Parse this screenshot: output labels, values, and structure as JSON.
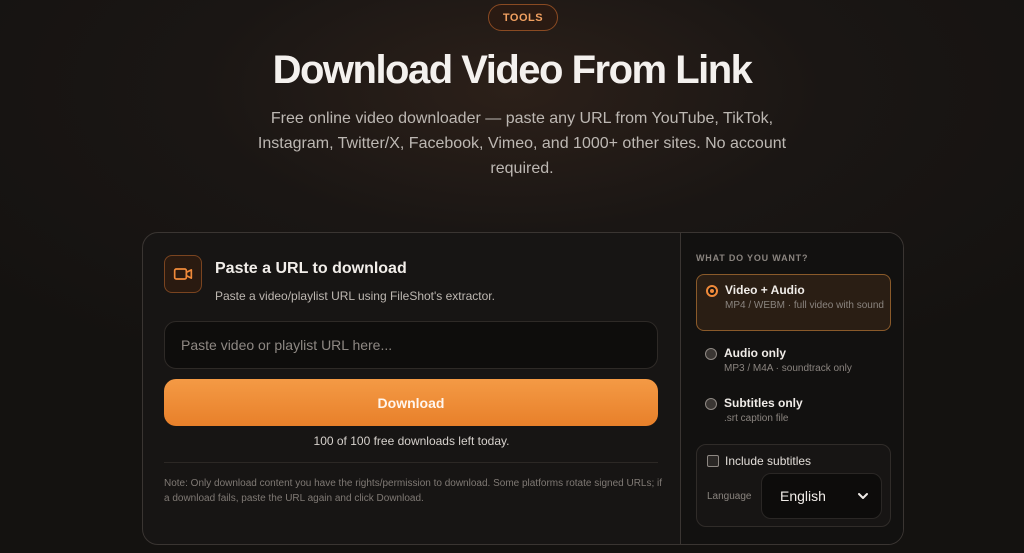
{
  "badge": "TOOLS",
  "hero": {
    "title": "Download Video From Link",
    "subtitle": "Free online video downloader — paste any URL from YouTube, TikTok, Instagram, Twitter/X, Facebook, Vimeo, and 1000+ other sites. No account required."
  },
  "panel": {
    "title": "Paste a URL to download",
    "subtitle": "Paste a video/playlist URL using FileShot's extractor.",
    "url_placeholder": "Paste video or playlist URL here...",
    "url_value": "",
    "download_label": "Download",
    "remaining": "100 of 100 free downloads left today.",
    "note": "Note: Only download content you have the rights/permission to download. Some platforms rotate signed URLs; if a download fails, paste the URL again and click Download."
  },
  "options": {
    "label": "WHAT DO YOU WANT?",
    "items": [
      {
        "title": "Video + Audio",
        "desc": "MP4 / WEBM · full video with sound",
        "selected": true
      },
      {
        "title": "Audio only",
        "desc": "MP3 / M4A · soundtrack only",
        "selected": false
      },
      {
        "title": "Subtitles only",
        "desc": ".srt caption file",
        "selected": false
      }
    ],
    "include_subtitles_label": "Include subtitles",
    "include_subtitles_checked": false,
    "language_label": "Language",
    "language_value": "English"
  },
  "icons": {
    "video": "video-camera-icon",
    "select": "chevron-down-icon"
  },
  "colors": {
    "accent": "#f08a3a",
    "button_top": "#f49a45",
    "button_bottom": "#e8802a",
    "background": "#141210"
  }
}
